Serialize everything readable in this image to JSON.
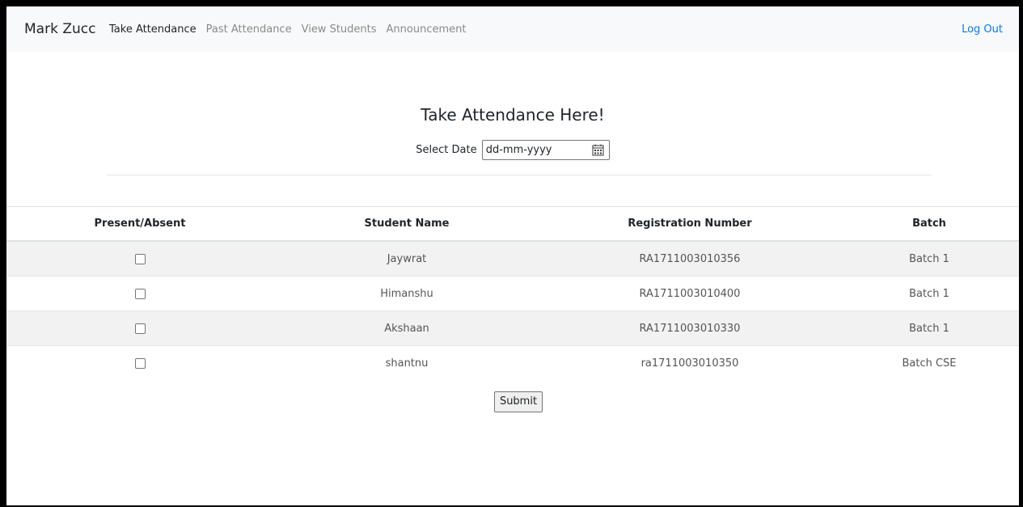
{
  "navbar": {
    "brand": "Mark Zucc",
    "links": [
      "Take Attendance",
      "Past Attendance",
      "View Students",
      "Announcement"
    ],
    "logout": "Log Out",
    "active_color": "#212529",
    "inactive_color": "#8a8a8a",
    "link_accent": "#007bff"
  },
  "page": {
    "title": "Take Attendance Here!",
    "date_label": "Select Date",
    "date_placeholder": "dd-mm-yyyy",
    "date_icon": "calendar-icon"
  },
  "table": {
    "headers": [
      "Present/Absent",
      "Student Name",
      "Registration Number",
      "Batch"
    ],
    "rows": [
      {
        "name": "Jaywrat",
        "reg": "RA1711003010356",
        "batch": "Batch 1",
        "present": false
      },
      {
        "name": "Himanshu",
        "reg": "RA1711003010400",
        "batch": "Batch 1",
        "present": false
      },
      {
        "name": "Akshaan",
        "reg": "RA1711003010330",
        "batch": "Batch 1",
        "present": false
      },
      {
        "name": "shantnu",
        "reg": "ra1711003010350",
        "batch": "Batch CSE",
        "present": false
      }
    ]
  },
  "actions": {
    "submit": "Submit"
  }
}
